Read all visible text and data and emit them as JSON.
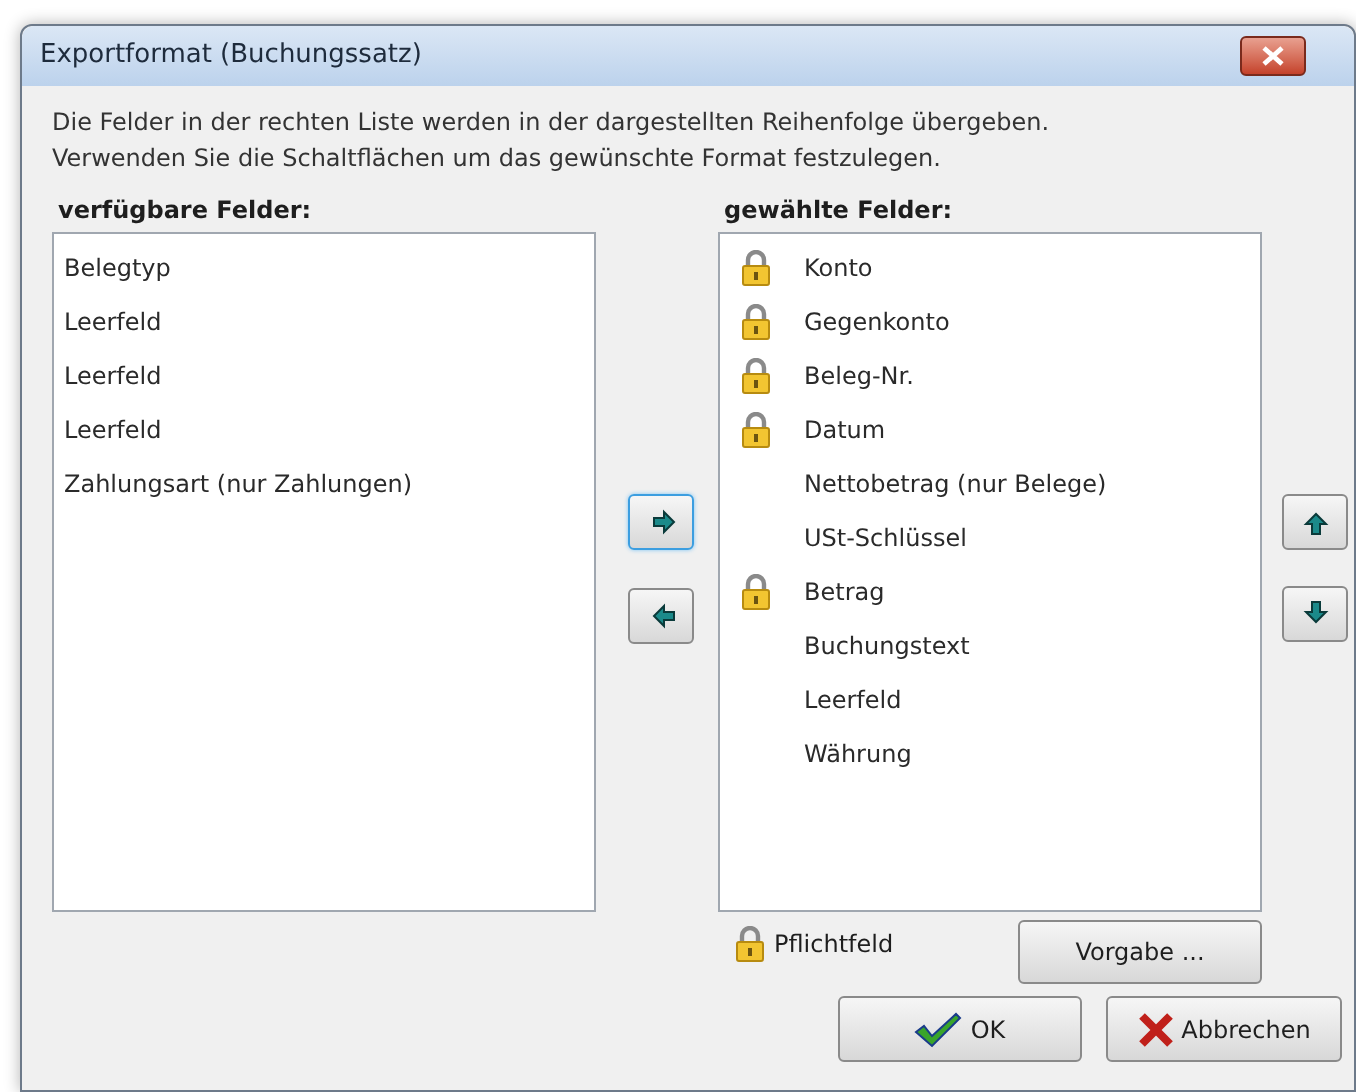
{
  "window": {
    "title": "Exportformat (Buchungssatz)"
  },
  "description": [
    "Die Felder in der rechten Liste werden in der dargestellten Reihenfolge übergeben.",
    "Verwenden Sie die Schaltflächen um das gewünschte Format festzulegen."
  ],
  "available": {
    "label": "verfügbare Felder:",
    "items": [
      {
        "text": "Belegtyp"
      },
      {
        "text": "Leerfeld"
      },
      {
        "text": "Leerfeld"
      },
      {
        "text": "Leerfeld"
      },
      {
        "text": "Zahlungsart (nur Zahlungen)"
      }
    ]
  },
  "move_buttons": [
    {
      "kind": "right",
      "focused": true
    },
    {
      "kind": "left",
      "focused": false
    }
  ],
  "selected": {
    "label": "gewählte Felder:",
    "items": [
      {
        "text": "Konto",
        "required": true
      },
      {
        "text": "Gegenkonto",
        "required": true
      },
      {
        "text": "Beleg-Nr.",
        "required": true
      },
      {
        "text": "Datum",
        "required": true
      },
      {
        "text": "Nettobetrag (nur Belege)",
        "required": false
      },
      {
        "text": "USt-Schlüssel",
        "required": false
      },
      {
        "text": "Betrag",
        "required": true
      },
      {
        "text": "Buchungstext",
        "required": false
      },
      {
        "text": "Leerfeld",
        "required": false
      },
      {
        "text": "Währung",
        "required": false
      }
    ]
  },
  "order_buttons": [
    {
      "kind": "up"
    },
    {
      "kind": "down"
    }
  ],
  "legend": "Pflichtfeld",
  "default_button": "Vorgabe ...",
  "ok_button": "OK",
  "cancel_button": "Abbrechen"
}
